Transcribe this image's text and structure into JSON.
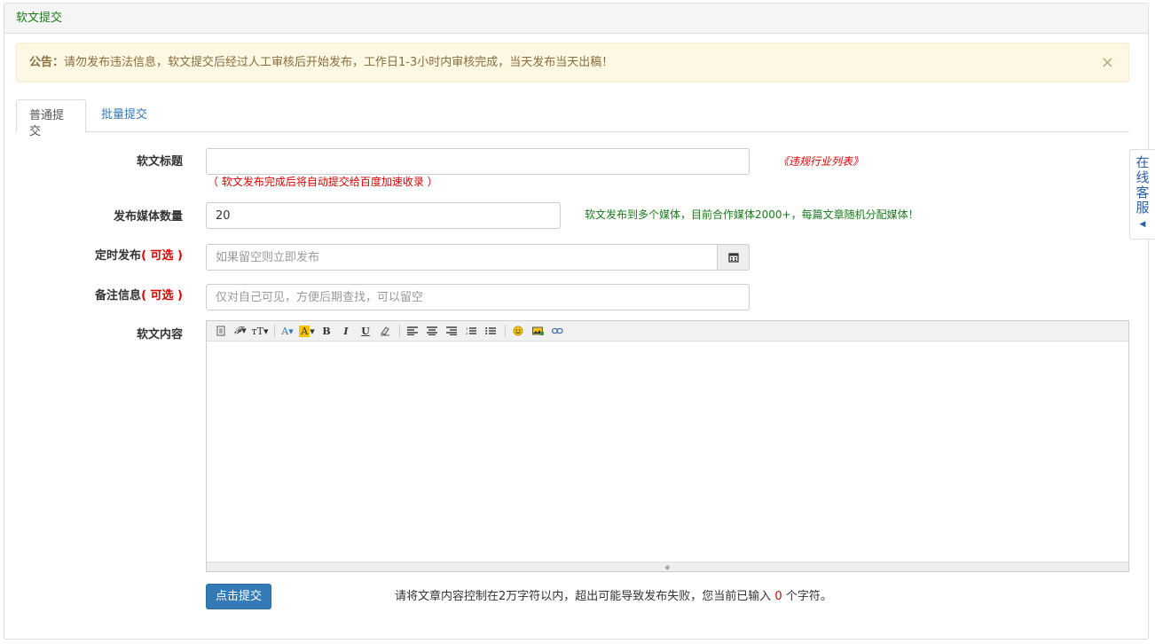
{
  "panel": {
    "title": "软文提交"
  },
  "notice": {
    "label": "公告：",
    "text": "请勿发布违法信息，软文提交后经过人工审核后开始发布，工作日1-3小时内审核完成，当天发布当天出稿！",
    "close": "×"
  },
  "tabs": [
    {
      "label": "普通提交",
      "active": true
    },
    {
      "label": "批量提交",
      "active": false
    }
  ],
  "form": {
    "title": {
      "label": "软文标题",
      "value": "",
      "link": "《违规行业列表》",
      "hint": "（ 软文发布完成后将自动提交给百度加速收录 ）"
    },
    "media_count": {
      "label": "发布媒体数量",
      "value": "20",
      "hint": "软文发布到多个媒体，目前合作媒体2000+，每篇文章随机分配媒体！"
    },
    "schedule": {
      "label": "定时发布",
      "optional": "( 可选 )",
      "placeholder": "如果留空则立即发布"
    },
    "remark": {
      "label": "备注信息",
      "optional": "( 可选 )",
      "placeholder": "仅对自己可见，方便后期查找，可以留空"
    },
    "content": {
      "label": "软文内容"
    }
  },
  "toolbar_icons": [
    "source-icon",
    "font-family-icon",
    "font-size-icon",
    "font-color-icon",
    "highlight-icon",
    "bold-icon",
    "italic-icon",
    "underline-icon",
    "clear-format-icon",
    "align-left-icon",
    "align-center-icon",
    "align-right-icon",
    "ordered-list-icon",
    "unordered-list-icon",
    "emoji-icon",
    "image-icon",
    "link-icon"
  ],
  "submit": {
    "label": "点击提交",
    "note_before": "请将文章内容控制在2万字符以内，超出可能导致发布失败，您当前已输入",
    "count": "0",
    "note_after": "个字符。"
  },
  "service": {
    "chars": [
      "在",
      "线",
      "客",
      "服"
    ]
  },
  "colors": {
    "primary": "#337ab7",
    "alert_bg": "#fcf8e3",
    "alert_text": "#8a6d3b",
    "green": "#1a7a1a",
    "red": "#dd0000"
  }
}
